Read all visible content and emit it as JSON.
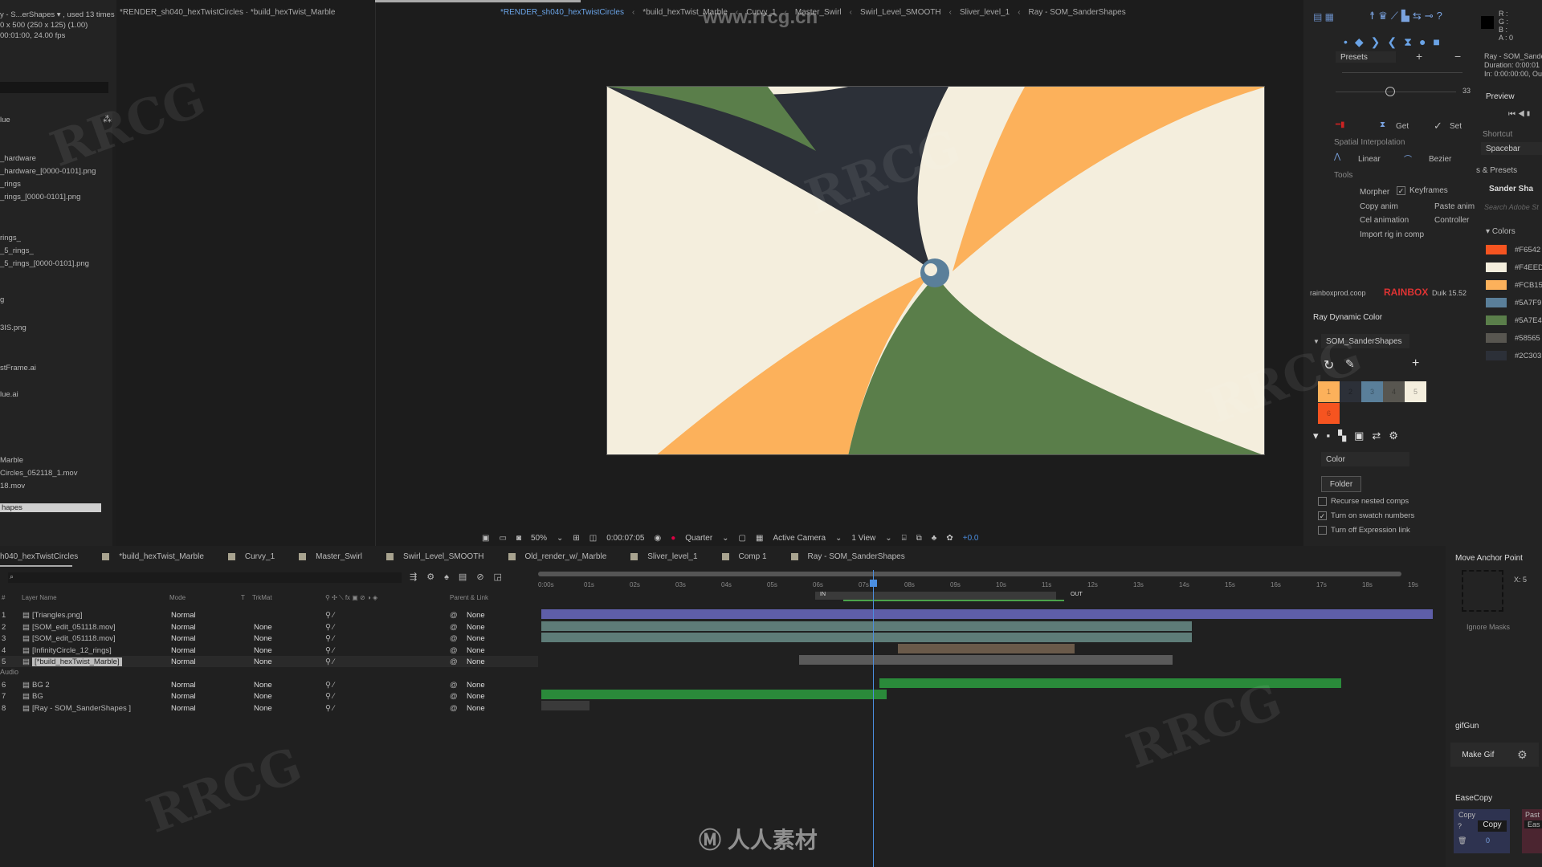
{
  "project": {
    "info_line1": "y - S...erShapes ▾ , used 13 times",
    "info_line2": "0 x 500  (250 x 125) (1.00)",
    "info_line3": "00:01:00, 24.00 fps",
    "column_label": "lue",
    "items": [
      "_hardware",
      "_hardware_[0000-0101].png",
      "_rings",
      "_rings_[0000-0101].png",
      "rings_",
      "_5_rings_",
      "_5_rings_[0000-0101].png",
      "g",
      "3IS.png",
      "stFrame.ai",
      "lue.ai",
      "Marble",
      "Circles_052118_1.mov",
      "18.mov"
    ],
    "selected_item": "hapes"
  },
  "viewer": {
    "header_tab": "*RENDER_sh040_hexTwistCircles · *build_hexTwist_Marble",
    "breadcrumbs": [
      "*RENDER_sh040_hexTwistCircles",
      "*build_hexTwist_Marble",
      "Curvy_1",
      "Master_Swirl",
      "Swirl_Level_SMOOTH",
      "Sliver_level_1",
      "Ray - SOM_SanderShapes"
    ],
    "zoom": "50%",
    "timecode": "0:00:07:05",
    "resolution": "Quarter",
    "camera": "Active Camera",
    "views": "1 View",
    "exposure": "+0.0"
  },
  "tools_panel": {
    "presets_label": "Presets",
    "slider_value": "33",
    "get_label": "Get",
    "set_label": "Set",
    "spatial_label": "Spatial Interpolation",
    "linear_label": "Linear",
    "bezier_label": "Bezier",
    "tools_label": "Tools",
    "morpher_label": "Morpher",
    "keyframes_label": "Keyframes",
    "copy_anim_label": "Copy anim",
    "paste_anim_label": "Paste anim",
    "cel_label": "Cel animation",
    "controller_label": "Controller",
    "import_rig_label": "Import rig in comp",
    "footer_site": "rainboxprod.coop",
    "footer_brand": "RAINBOX",
    "footer_version": "Duik 15.52"
  },
  "ray_dynamic_color": {
    "title": "Ray Dynamic Color",
    "palette": "SOM_SanderShapes",
    "swatches": [
      {
        "n": "1",
        "color": "#FCB15B"
      },
      {
        "n": "2",
        "color": "#2C3038"
      },
      {
        "n": "3",
        "color": "#5A7F9A"
      },
      {
        "n": "4",
        "color": "#585650"
      },
      {
        "n": "5",
        "color": "#F4EEDD"
      },
      {
        "n": "6",
        "color": "#F65420"
      }
    ],
    "mode": "Color",
    "folder_button": "Folder",
    "recurse_label": "Recurse nested comps",
    "recurse_checked": false,
    "swatch_numbers_label": "Turn on swatch numbers",
    "swatch_numbers_checked": true,
    "expression_label": "Turn off Expression link",
    "expression_checked": false
  },
  "info_panel": {
    "r": "R :",
    "g": "G :",
    "b": "B :",
    "a": "A :  0",
    "layer_name": "Ray - SOM_Sande",
    "duration": "Duration: 0:00:01",
    "inout": "In: 0:00:00:00, Ou",
    "preview_title": "Preview",
    "shortcut_label": "Shortcut",
    "shortcut_value": "Spacebar",
    "effects_title": "s & Presets",
    "effects_item": "Sander Sha",
    "search_placeholder": "Search Adobe St",
    "colors_title": "Colors",
    "colors": [
      {
        "hex": "#F6542",
        "swatch": "#F65420"
      },
      {
        "hex": "#F4EED",
        "swatch": "#F4EEDD"
      },
      {
        "hex": "#FCB15",
        "swatch": "#FCB15B"
      },
      {
        "hex": "#5A7F9",
        "swatch": "#5A7F9A"
      },
      {
        "hex": "#5A7E4",
        "swatch": "#5A7E4A"
      },
      {
        "hex": "#58565",
        "swatch": "#585650"
      },
      {
        "hex": "#2C303",
        "swatch": "#2C3038"
      }
    ]
  },
  "timeline": {
    "tabs": [
      "h040_hexTwistCircles",
      "*build_hexTwist_Marble",
      "Curvy_1",
      "Master_Swirl",
      "Swirl_Level_SMOOTH",
      "Old_render_w/_Marble",
      "Sliver_level_1",
      "Comp 1",
      "Ray - SOM_SanderShapes"
    ],
    "columns": {
      "num": "#",
      "name": "Layer Name",
      "mode": "Mode",
      "t": "T",
      "trkmat": "TrkMat",
      "parent": "Parent & Link"
    },
    "ruler": [
      "0:00s",
      "01s",
      "02s",
      "03s",
      "04s",
      "05s",
      "06s",
      "07s",
      "08s",
      "09s",
      "10s",
      "11s",
      "12s",
      "13s",
      "14s",
      "15s",
      "16s",
      "17s",
      "18s",
      "19s"
    ],
    "in_label": "IN",
    "out_label": "OUT",
    "audio_label": "Audio",
    "layers": [
      {
        "num": "1",
        "name": "[Triangles.png]",
        "mode": "Normal",
        "trkmat": "",
        "parent": "None"
      },
      {
        "num": "2",
        "name": "[SOM_edit_051118.mov]",
        "mode": "Normal",
        "trkmat": "None",
        "parent": "None"
      },
      {
        "num": "3",
        "name": "[SOM_edit_051118.mov]",
        "mode": "Normal",
        "trkmat": "None",
        "parent": "None"
      },
      {
        "num": "4",
        "name": "[InfinityCircle_12_rings]",
        "mode": "Normal",
        "trkmat": "None",
        "parent": "None"
      },
      {
        "num": "5",
        "name": "[*build_hexTwist_Marble]",
        "mode": "Normal",
        "trkmat": "None",
        "parent": "None"
      },
      {
        "num": "6",
        "name": "BG 2",
        "mode": "Normal",
        "trkmat": "None",
        "parent": "None"
      },
      {
        "num": "7",
        "name": "BG",
        "mode": "Normal",
        "trkmat": "None",
        "parent": "None"
      },
      {
        "num": "8",
        "name": "[Ray - SOM_SanderShapes ]",
        "mode": "Normal",
        "trkmat": "None",
        "parent": "None"
      }
    ]
  },
  "side_panels": {
    "anchor_title": "Move Anchor Point",
    "anchor_x": "X:  5",
    "ignore_masks": "Ignore Masks",
    "gifgun_title": "gifGun",
    "make_gif": "Make Gif",
    "easecopy_title": "EaseCopy",
    "copy_group": "Copy",
    "copy_button": "Copy",
    "copy_count": "0",
    "paste_group": "Past",
    "paste_button": "Eas"
  },
  "watermark": {
    "site": "www.rrcg.cn",
    "brand": "人人素材",
    "mark": "RRCG"
  }
}
